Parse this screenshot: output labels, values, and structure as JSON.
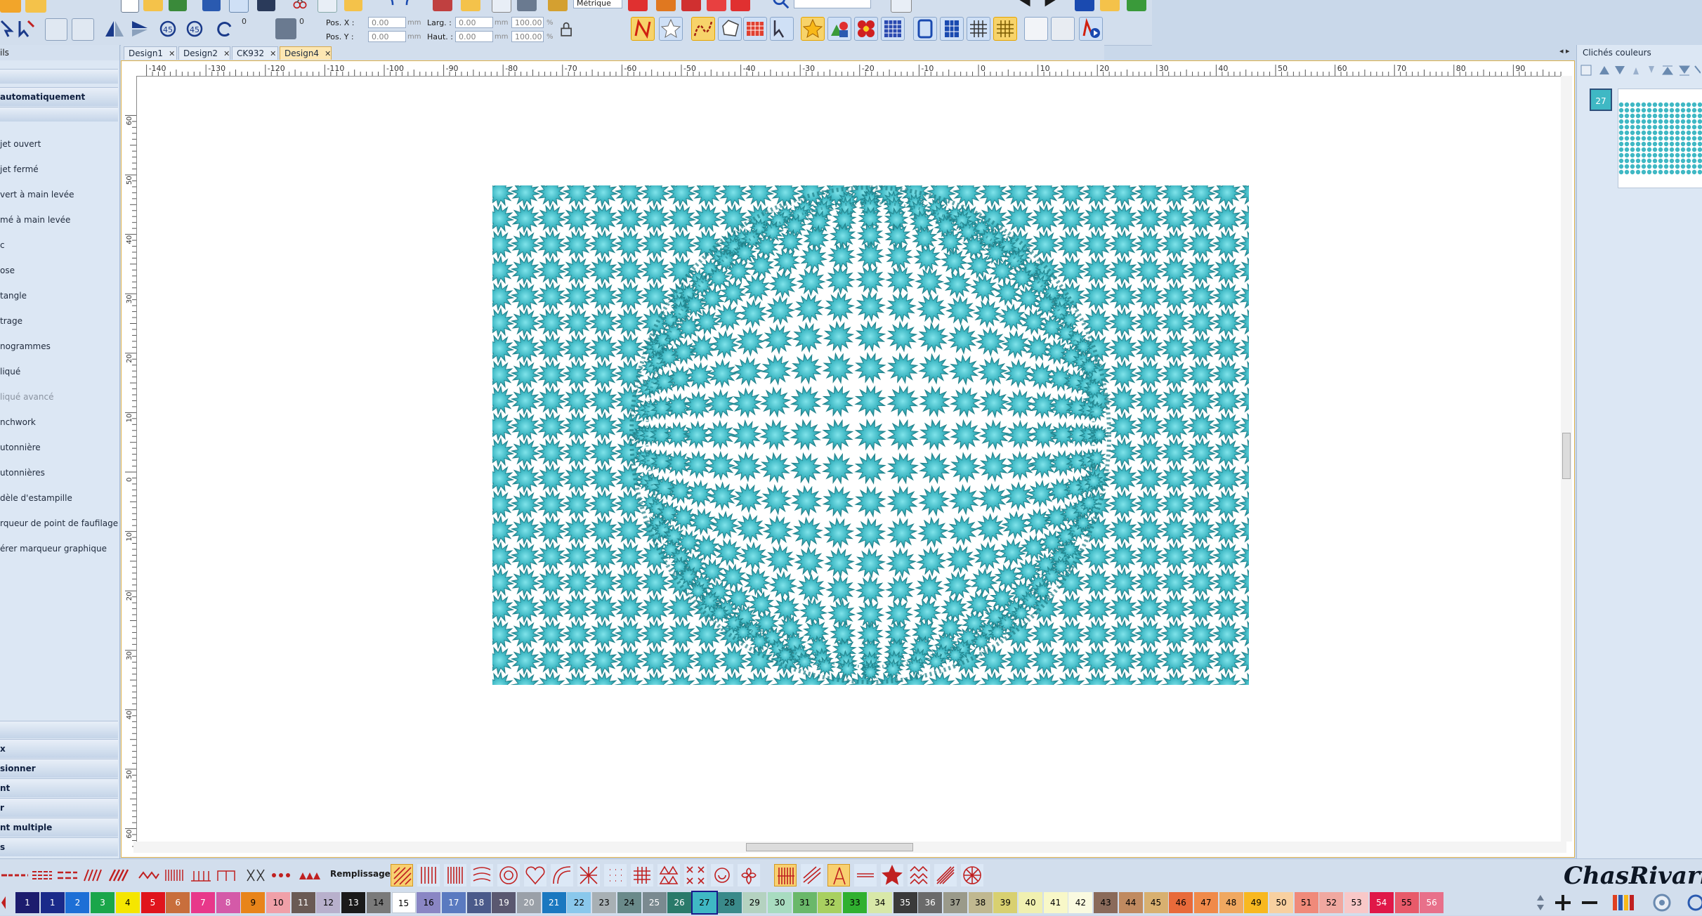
{
  "toolbar": {
    "pos_x_label": "Pos. X :",
    "pos_y_label": "Pos. Y :",
    "pos_x_value": "0.00",
    "pos_y_value": "0.00",
    "width_label": "Larg. :",
    "height_label": "Haut. :",
    "width_value": "0.00",
    "height_value": "0.00",
    "width_pct": "100.00",
    "height_pct": "100.00",
    "unit_mm": "mm",
    "unit_pct": "%",
    "rotate_value": "0",
    "metric_label": "Métrique"
  },
  "left_panel": {
    "top_label": "ils",
    "band_auto": "automatiquement",
    "items": [
      "jet ouvert",
      "jet fermé",
      "vert à main levée",
      "mé à main levée",
      "c",
      "ose",
      "tangle",
      "trage",
      "nogrammes",
      "liqué",
      "liqué avancé",
      "nchwork",
      "utonnière",
      "utonnières",
      "dèle d'estampille",
      "rqueur de point de faufilage",
      "érer marqueur graphique"
    ],
    "bottom_bands": [
      "x",
      "sionner",
      "nt",
      "r",
      "nt multiple",
      "s"
    ]
  },
  "tabs": [
    {
      "label": "Design1",
      "active": false
    },
    {
      "label": "Design2",
      "active": false
    },
    {
      "label": "CK932",
      "active": false
    },
    {
      "label": "Design4",
      "active": true
    }
  ],
  "ruler": {
    "h_labels": [
      "-140",
      "-130",
      "-120",
      "-110",
      "-100",
      "-90",
      "-80",
      "-70",
      "-60",
      "-50",
      "-40",
      "-30",
      "-20",
      "-10",
      "0",
      "10",
      "20",
      "30",
      "40",
      "50",
      "60",
      "70",
      "80",
      "90"
    ],
    "v_labels": [
      "60",
      "50",
      "40",
      "30",
      "20",
      "10",
      "0",
      "10",
      "20",
      "30",
      "40",
      "50",
      "60"
    ]
  },
  "design": {
    "thread_color": "#3fb8c4",
    "thread_dark": "#1f7f88"
  },
  "right_panel": {
    "title": "Clichés couleurs",
    "swatch_number": "27"
  },
  "stitch_bar": {
    "fills_label": "Remplissages :",
    "brand": "ChasRivari"
  },
  "palette": [
    {
      "n": "1",
      "bg": "#1c1c6e",
      "fg": "#ffffff"
    },
    {
      "n": "1",
      "bg": "#1a2a8a",
      "fg": "#ffffff"
    },
    {
      "n": "2",
      "bg": "#1d6fd6",
      "fg": "#ffffff"
    },
    {
      "n": "3",
      "bg": "#1aa64a",
      "fg": "#ffffff"
    },
    {
      "n": "4",
      "bg": "#f5e600",
      "fg": "#000000"
    },
    {
      "n": "5",
      "bg": "#e0141c",
      "fg": "#ffffff"
    },
    {
      "n": "6",
      "bg": "#c86e3c",
      "fg": "#ffffff"
    },
    {
      "n": "7",
      "bg": "#e8388a",
      "fg": "#ffffff"
    },
    {
      "n": "8",
      "bg": "#d45aa8",
      "fg": "#ffffff"
    },
    {
      "n": "9",
      "bg": "#e8841a",
      "fg": "#000000"
    },
    {
      "n": "10",
      "bg": "#f0a0a8",
      "fg": "#000000"
    },
    {
      "n": "11",
      "bg": "#6a5a54",
      "fg": "#ffffff"
    },
    {
      "n": "12",
      "bg": "#b8b0cc",
      "fg": "#000000"
    },
    {
      "n": "13",
      "bg": "#1a1a1a",
      "fg": "#ffffff"
    },
    {
      "n": "14",
      "bg": "#7a7a7a",
      "fg": "#000000"
    },
    {
      "n": "15",
      "bg": "#ffffff",
      "fg": "#000000"
    },
    {
      "n": "16",
      "bg": "#8a86c4",
      "fg": "#000000"
    },
    {
      "n": "17",
      "bg": "#5a7ac0",
      "fg": "#ffffff"
    },
    {
      "n": "18",
      "bg": "#4a5a8a",
      "fg": "#ffffff"
    },
    {
      "n": "19",
      "bg": "#5a5870",
      "fg": "#ffffff"
    },
    {
      "n": "20",
      "bg": "#9aa0a8",
      "fg": "#ffffff"
    },
    {
      "n": "21",
      "bg": "#1a78c0",
      "fg": "#ffffff"
    },
    {
      "n": "22",
      "bg": "#8ac8ec",
      "fg": "#000000"
    },
    {
      "n": "23",
      "bg": "#a8b0b4",
      "fg": "#000000"
    },
    {
      "n": "24",
      "bg": "#6a8a8a",
      "fg": "#000000"
    },
    {
      "n": "25",
      "bg": "#7a8a90",
      "fg": "#ffffff"
    },
    {
      "n": "26",
      "bg": "#2a7a6a",
      "fg": "#ffffff"
    },
    {
      "n": "27",
      "bg": "#3fb8c4",
      "fg": "#000000"
    },
    {
      "n": "28",
      "bg": "#3a8a8a",
      "fg": "#000000"
    },
    {
      "n": "29",
      "bg": "#b4d2c0",
      "fg": "#000000"
    },
    {
      "n": "30",
      "bg": "#a8dcc0",
      "fg": "#000000"
    },
    {
      "n": "31",
      "bg": "#6ab86a",
      "fg": "#000000"
    },
    {
      "n": "32",
      "bg": "#a8d060",
      "fg": "#000000"
    },
    {
      "n": "33",
      "bg": "#30b030",
      "fg": "#000000"
    },
    {
      "n": "34",
      "bg": "#d8e8a8",
      "fg": "#000000"
    },
    {
      "n": "35",
      "bg": "#3a3a3a",
      "fg": "#ffffff"
    },
    {
      "n": "36",
      "bg": "#6a6a6a",
      "fg": "#ffffff"
    },
    {
      "n": "37",
      "bg": "#9a9a8a",
      "fg": "#000000"
    },
    {
      "n": "38",
      "bg": "#c0b890",
      "fg": "#000000"
    },
    {
      "n": "39",
      "bg": "#d8d070",
      "fg": "#000000"
    },
    {
      "n": "40",
      "bg": "#f0f0b0",
      "fg": "#000000"
    },
    {
      "n": "41",
      "bg": "#f8f8c8",
      "fg": "#000000"
    },
    {
      "n": "42",
      "bg": "#fafae0",
      "fg": "#000000"
    },
    {
      "n": "43",
      "bg": "#8a6a5a",
      "fg": "#000000"
    },
    {
      "n": "44",
      "bg": "#c08a60",
      "fg": "#000000"
    },
    {
      "n": "45",
      "bg": "#d8b070",
      "fg": "#000000"
    },
    {
      "n": "46",
      "bg": "#e86a3a",
      "fg": "#000000"
    },
    {
      "n": "47",
      "bg": "#f08a4a",
      "fg": "#000000"
    },
    {
      "n": "48",
      "bg": "#f0a860",
      "fg": "#000000"
    },
    {
      "n": "49",
      "bg": "#f8b820",
      "fg": "#000000"
    },
    {
      "n": "50",
      "bg": "#f8d0a0",
      "fg": "#000000"
    },
    {
      "n": "51",
      "bg": "#f08a7a",
      "fg": "#000000"
    },
    {
      "n": "52",
      "bg": "#f0a8a0",
      "fg": "#000000"
    },
    {
      "n": "53",
      "bg": "#f8c8c8",
      "fg": "#000000"
    },
    {
      "n": "54",
      "bg": "#e01848",
      "fg": "#ffffff"
    },
    {
      "n": "55",
      "bg": "#e85a6a",
      "fg": "#000000"
    },
    {
      "n": "56",
      "bg": "#e8708a",
      "fg": "#ffffff"
    }
  ]
}
